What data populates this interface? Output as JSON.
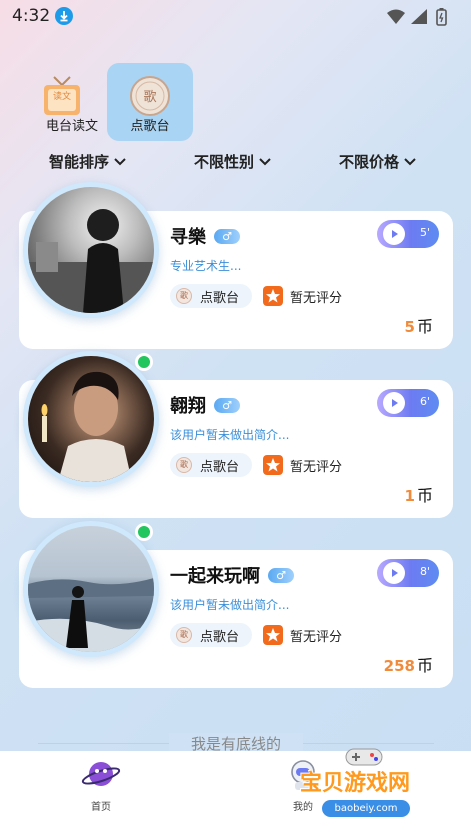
{
  "status_bar": {
    "time": "4:32"
  },
  "tabs": [
    {
      "label": "电台读文",
      "icon": "radio-read-icon",
      "icon_text": "读文",
      "active": false
    },
    {
      "label": "点歌台",
      "icon": "song-request-icon",
      "icon_text": "歌",
      "active": true
    }
  ],
  "filters": [
    {
      "label": "智能排序"
    },
    {
      "label": "不限性别"
    },
    {
      "label": "不限价格"
    }
  ],
  "cards": [
    {
      "name": "寻樂",
      "gender": "♂",
      "bio": "专业艺术生...",
      "tag": "点歌台",
      "tag_icon_text": "歌",
      "rating": "暂无评分",
      "voice_duration": "5'",
      "price": "5",
      "price_unit": "币",
      "online": false
    },
    {
      "name": "翱翔",
      "gender": "♂",
      "bio": "该用户暂未做出简介...",
      "tag": "点歌台",
      "tag_icon_text": "歌",
      "rating": "暂无评分",
      "voice_duration": "6'",
      "price": "1",
      "price_unit": "币",
      "online": true
    },
    {
      "name": "一起来玩啊",
      "gender": "♂",
      "bio": "该用户暂未做出简介...",
      "tag": "点歌台",
      "tag_icon_text": "歌",
      "rating": "暂无评分",
      "voice_duration": "8'",
      "price": "258",
      "price_unit": "币",
      "online": true
    }
  ],
  "footer": {
    "end_text": "我是有底线的"
  },
  "bottom_nav": [
    {
      "label": "首页",
      "icon": "planet-icon"
    },
    {
      "label": "我的",
      "icon": "astronaut-icon"
    }
  ],
  "watermark": {
    "text": "宝贝游戏网",
    "url": "baobeiy.com"
  },
  "colors": {
    "accent_blue": "#3b8fd8",
    "price_orange": "#f08b3c",
    "online_green": "#22c55e",
    "active_tab": "#aad4f3"
  }
}
